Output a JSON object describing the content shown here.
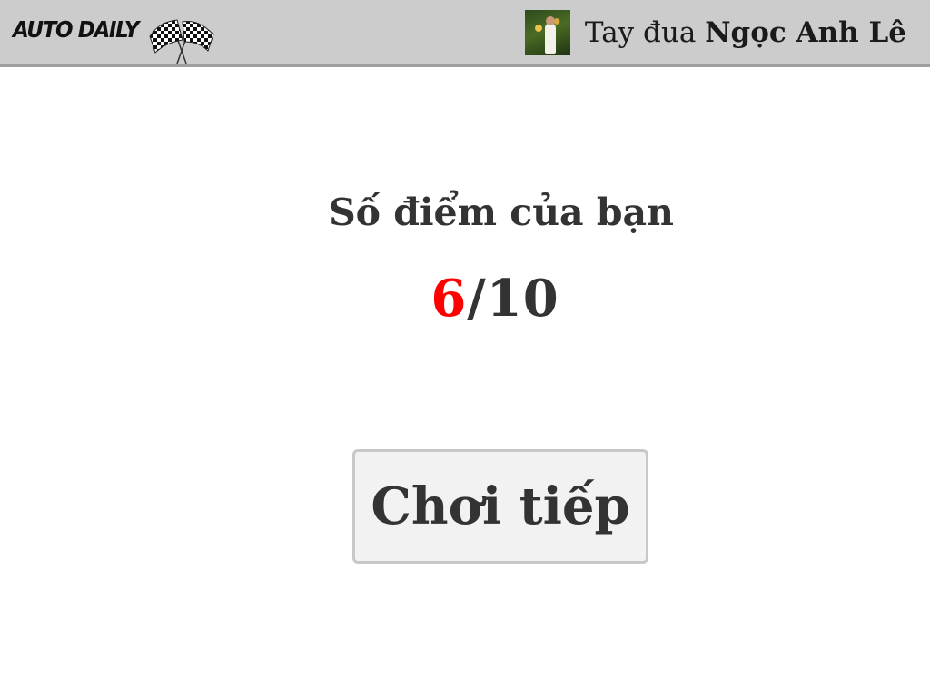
{
  "header": {
    "logo_text": "AUTO DAILY",
    "flags_icon": "checkered-flags-icon",
    "racer_prefix": "Tay đua ",
    "racer_name": "Ngọc Anh Lê",
    "avatar_icon": "avatar-photo"
  },
  "result": {
    "title": "Số điểm của bạn",
    "score": "6",
    "separator_total": "/10"
  },
  "actions": {
    "continue_label": "Chơi tiếp"
  },
  "colors": {
    "header_bg": "#cccccc",
    "header_border": "#9e9e9e",
    "score_accent": "#ff0000",
    "text": "#333333",
    "button_bg": "#f2f2f2",
    "button_border": "#c8c8c8"
  }
}
